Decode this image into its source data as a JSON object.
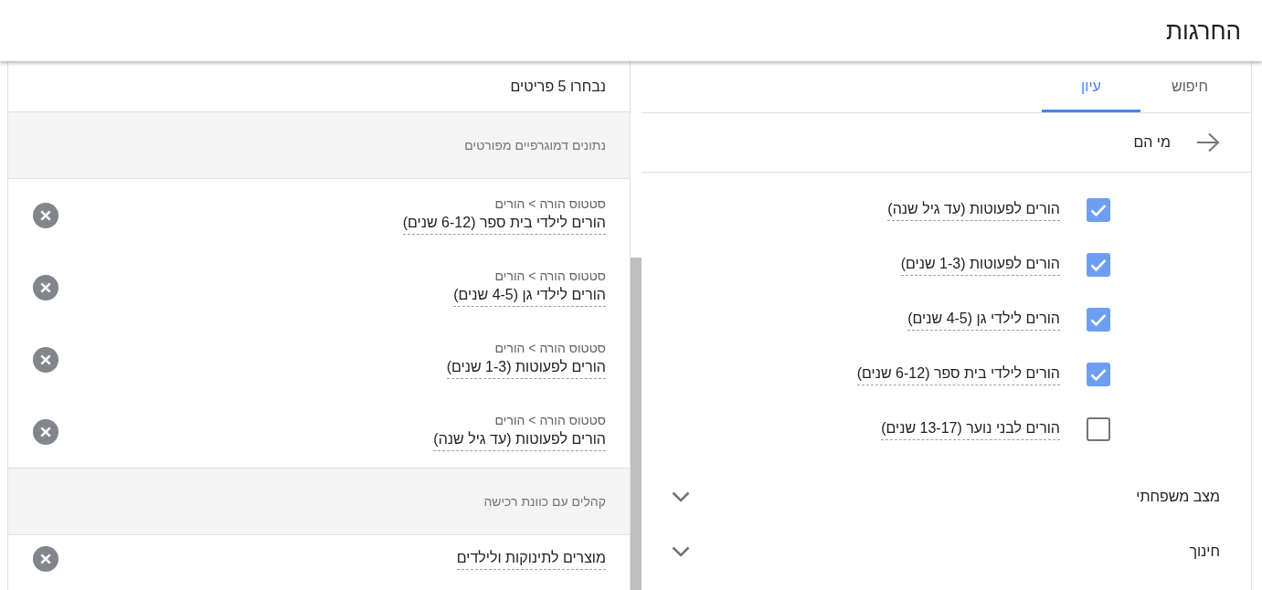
{
  "header": {
    "title": "החרגות"
  },
  "browse_panel": {
    "tabs": [
      {
        "label": "חיפוש",
        "selected": false
      },
      {
        "label": "עיון",
        "selected": true
      }
    ],
    "breadcrumb": {
      "label": "מי הם"
    },
    "options": [
      {
        "label": "הורים לפעוטות (עד גיל שנה)",
        "checked": true
      },
      {
        "label": "הורים לפעוטות (1-3 שנים)",
        "checked": true
      },
      {
        "label": "הורים לילדי גן (4-5 שנים)",
        "checked": true
      },
      {
        "label": "הורים לילדי בית ספר (6-12 שנים)",
        "checked": true
      },
      {
        "label": "הורים לבני נוער (13-17 שנים)",
        "checked": false
      }
    ],
    "categories": [
      {
        "label": "מצב משפחתי",
        "expanded": false
      },
      {
        "label": "חינוך",
        "expanded": false
      }
    ]
  },
  "selection_panel": {
    "summary": "נבחרו 5 פריטים",
    "groups": [
      {
        "title": "נתונים דמוגרפיים מפורטים",
        "items": [
          {
            "category": "סטטוס הורה > הורים",
            "value": "הורים לילדי בית ספר (6-12 שנים)"
          },
          {
            "category": "סטטוס הורה > הורים",
            "value": "הורים לילדי גן (4-5 שנים)"
          },
          {
            "category": "סטטוס הורה > הורים",
            "value": "הורים לפעוטות (1-3 שנים)"
          },
          {
            "category": "סטטוס הורה > הורים",
            "value": "הורים לפעוטות (עד גיל שנה)"
          }
        ]
      },
      {
        "title": "קהלים עם כוונת רכישה",
        "items": [
          {
            "value": "מוצרים לתינוקות ולילדים"
          }
        ]
      }
    ]
  }
}
